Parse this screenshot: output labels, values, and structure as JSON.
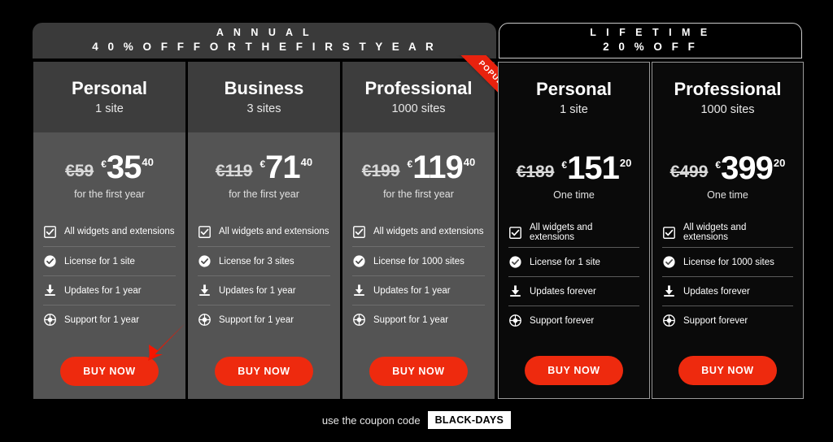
{
  "groups": [
    {
      "id": "annual",
      "line1": "A N N U A L",
      "line2": "4 0 %  O F F  F O R  T H E  F I R S T  Y E A R"
    },
    {
      "id": "lifetime",
      "line1": "L I F E T I M E",
      "line2": "2 0 %  O F F"
    }
  ],
  "cards": [
    {
      "plan": "Personal",
      "sites": "1 site",
      "old_price": "€59",
      "currency": "€",
      "amount": "35",
      "decimals": "40",
      "note": "for the first year",
      "features": [
        "All widgets and extensions",
        "License for 1 site",
        "Updates for 1 year",
        "Support for 1 year"
      ],
      "buy_label": "BUY NOW",
      "ribbon": ""
    },
    {
      "plan": "Business",
      "sites": "3 sites",
      "old_price": "€119",
      "currency": "€",
      "amount": "71",
      "decimals": "40",
      "note": "for the first year",
      "features": [
        "All widgets and extensions",
        "License for 3 sites",
        "Updates for 1 year",
        "Support for 1 year"
      ],
      "buy_label": "BUY NOW",
      "ribbon": ""
    },
    {
      "plan": "Professional",
      "sites": "1000 sites",
      "old_price": "€199",
      "currency": "€",
      "amount": "119",
      "decimals": "40",
      "note": "for the first year",
      "features": [
        "All widgets and extensions",
        "License for 1000 sites",
        "Updates for 1 year",
        "Support for 1 year"
      ],
      "buy_label": "BUY NOW",
      "ribbon": "POPULAR"
    },
    {
      "plan": "Personal",
      "sites": "1 site",
      "old_price": "€189",
      "currency": "€",
      "amount": "151",
      "decimals": "20",
      "note": "One time",
      "features": [
        "All widgets and extensions",
        "License for 1 site",
        "Updates forever",
        "Support forever"
      ],
      "buy_label": "BUY NOW",
      "ribbon": ""
    },
    {
      "plan": "Professional",
      "sites": "1000 sites",
      "old_price": "€499",
      "currency": "€",
      "amount": "399",
      "decimals": "20",
      "note": "One time",
      "features": [
        "All widgets and extensions",
        "License for 1000 sites",
        "Updates forever",
        "Support forever"
      ],
      "buy_label": "BUY NOW",
      "ribbon": ""
    }
  ],
  "footer": {
    "text": "use the coupon code",
    "coupon": "BLACK-DAYS"
  },
  "icons": [
    "checkbox-checked-icon",
    "check-circle-icon",
    "download-icon",
    "lifebuoy-icon"
  ],
  "colors": {
    "page_background": "#000000",
    "accent_red": "#ee2a0e",
    "annual_card_body": "#545454",
    "annual_card_head": "#3d3d3d",
    "group_header_annual": "#3a3a3a",
    "lifetime_card": "#0a0a0a",
    "text_primary": "#ffffff"
  }
}
